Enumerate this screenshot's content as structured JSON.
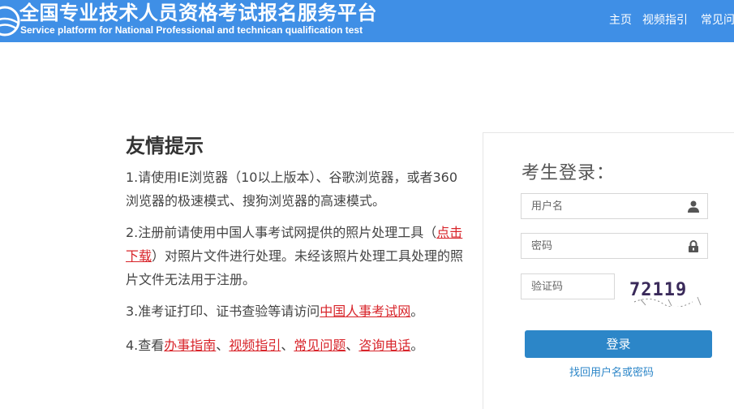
{
  "header": {
    "title_cn": "全国专业技术人员资格考试报名服务平台",
    "title_en": "Service platform for National Professional and technican qualification test",
    "nav": [
      "主页",
      "视频指引",
      "常见问"
    ],
    "bg_color": "#3f8fe6"
  },
  "tips": {
    "title": "友情提示",
    "tip1": "1.请使用IE浏览器（10以上版本）、谷歌浏览器，或者360浏览器的极速模式、搜狗浏览器的高速模式。",
    "tip2_a": "2.注册前请使用中国人事考试网提供的照片处理工具（",
    "tip2_link": "点击下载",
    "tip2_b": "）对照片文件进行处理。未经该照片处理工具处理的照片文件无法用于注册。",
    "tip3_a": "3.准考证打印、证书查验等请访问",
    "tip3_link": "中国人事考试网",
    "tip3_b": "。",
    "tip4_a": "4.查看",
    "tip4_links": [
      "办事指南",
      "视频指引",
      "常见问题",
      "咨询电话"
    ],
    "tip4_sep": "、",
    "tip4_end": "。",
    "link_color": "#d8242a"
  },
  "login": {
    "title": "考生登录：",
    "username_placeholder": "用户名",
    "password_placeholder": "密码",
    "captcha_placeholder": "验证码",
    "captcha_text": "72119",
    "button": "登录",
    "recover_link": "找回用户名或密码",
    "accent_color": "#2c86c8"
  }
}
